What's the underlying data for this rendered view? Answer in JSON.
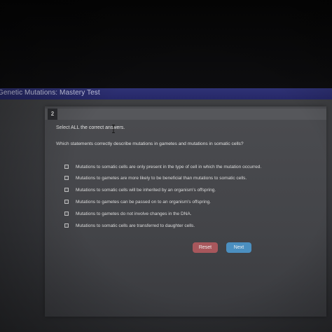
{
  "header": {
    "title": "Genetic Mutations: Mastery Test"
  },
  "question": {
    "number": "2",
    "instruction": "Select ALL the correct answers.",
    "text": "Which statements correctly describe mutations in gametes and mutations in somatic cells?",
    "options": [
      {
        "label": "Mutations to somatic cells are only present in the type of cell in which the mutation occurred."
      },
      {
        "label": "Mutations to gametes are more likely to be beneficial than mutations to somatic cells."
      },
      {
        "label": "Mutations to somatic cells will be inherited by an organism's offspring."
      },
      {
        "label": "Mutations to gametes can be passed on to an organism's offspring."
      },
      {
        "label": "Mutations to gametes do not involve changes in the DNA."
      },
      {
        "label": "Mutations to somatic cells are transferred to daughter cells."
      }
    ]
  },
  "actions": {
    "reset_label": "Reset",
    "next_label": "Next"
  },
  "icons": {
    "cursor": "text-cursor-icon"
  },
  "colors": {
    "title_bar": "#2f3275",
    "reset_button": "#a8575c",
    "next_button": "#4b8fc0"
  }
}
